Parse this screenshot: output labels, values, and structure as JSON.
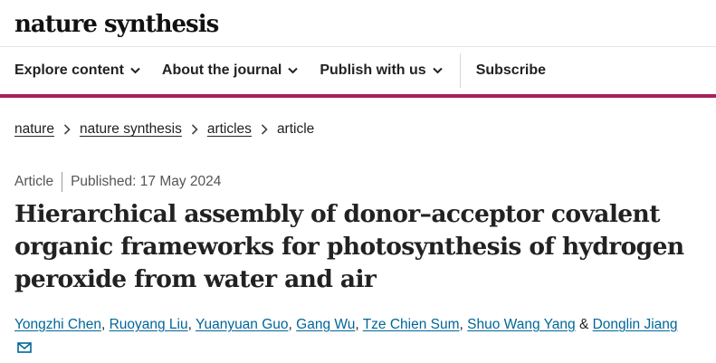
{
  "header": {
    "logo": "nature synthesis"
  },
  "nav": {
    "items": [
      {
        "label": "Explore content"
      },
      {
        "label": "About the journal"
      },
      {
        "label": "Publish with us"
      }
    ],
    "subscribe": "Subscribe"
  },
  "breadcrumb": {
    "items": [
      "nature",
      "nature synthesis",
      "articles"
    ],
    "current": "article"
  },
  "article": {
    "type": "Article",
    "published": "Published: 17 May 2024",
    "title": "Hierarchical assembly of donor–acceptor covalent organic frameworks for photosynthesis of hydrogen peroxide from water and air",
    "authors": [
      "Yongzhi Chen",
      "Ruoyang Liu",
      "Yuanyuan Guo",
      "Gang Wu",
      "Tze Chien Sum",
      "Shuo Wang Yang",
      "Donglin Jiang"
    ],
    "author_separator": ", ",
    "author_last_separator": " & "
  },
  "colors": {
    "accent": "#a8205f",
    "link": "#006699"
  },
  "icons": {
    "nav_chevron": "chevron-down-icon",
    "breadcrumb_separator": "chevron-right-icon",
    "corresponding_author": "mail-icon"
  }
}
